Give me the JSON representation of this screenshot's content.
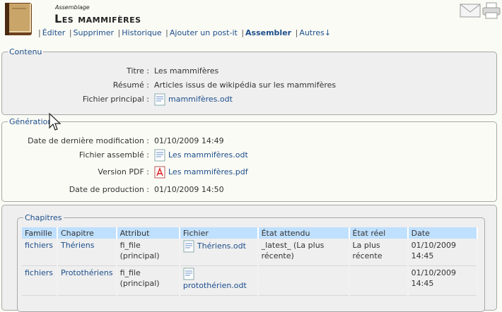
{
  "header": {
    "kind": "Assemblage",
    "title": "Les mammifères",
    "actions": [
      "Éditer",
      "Supprimer",
      "Historique",
      "Ajouter un post-it",
      "Assembler",
      "Autres↓"
    ]
  },
  "contenu": {
    "legend": "Contenu",
    "titre_label": "Titre :",
    "titre_value": "Les mammifères",
    "resume_label": "Résumé :",
    "resume_value": "Articles issus de wikipédia sur les mammifères",
    "fichier_label": "Fichier principal :",
    "fichier_value": "mammifères.odt"
  },
  "generation": {
    "legend": "Génération",
    "date_modif_label": "Date de dernière modification :",
    "date_modif_value": "01/10/2009 14:49",
    "fichier_assemble_label": "Fichier assemblé :",
    "fichier_assemble_value": "Les mammifères.odt",
    "pdf_label": "Version PDF :",
    "pdf_value": "Les mammifères.pdf",
    "date_prod_label": "Date de production :",
    "date_prod_value": "01/10/2009 14:50"
  },
  "chapitres": {
    "legend": "Chapitres",
    "columns": [
      "Famille",
      "Chapitre",
      "Attribut",
      "Fichier",
      "État attendu",
      "État réel",
      "Date"
    ],
    "rows": [
      {
        "famille": "fichiers",
        "chapitre": "Thériens",
        "attribut": "fi_file (principal)",
        "fichier": "Thériens.odt",
        "etat_attendu": "_latest_ (La plus récente)",
        "etat_reel": "La plus récente",
        "date": "01/10/2009 14:45"
      },
      {
        "famille": "fichiers",
        "chapitre": "Protothériens",
        "attribut": "fi_file (principal)",
        "fichier": "protothérien.odt",
        "etat_attendu": "",
        "etat_reel": "",
        "date": "01/10/2009 14:45"
      }
    ]
  },
  "colors": {
    "link": "#1c4e8c",
    "table_header": "#bfe0ff",
    "panel": "#efefef"
  }
}
